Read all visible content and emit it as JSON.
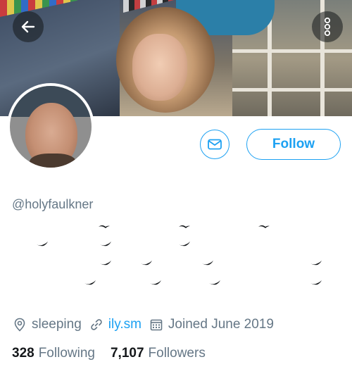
{
  "profile": {
    "handle": "@holyfaulkner",
    "location": "sleeping",
    "website": "ily.sm",
    "joined": "Joined June 2019"
  },
  "actions": {
    "follow_label": "Follow"
  },
  "stats": {
    "following_count": "328",
    "following_label": "Following",
    "followers_count": "7,107",
    "followers_label": "Followers"
  },
  "colors": {
    "accent": "#1da1f2",
    "secondary_text": "#657786",
    "primary_text": "#14171a"
  },
  "icons": {
    "back": "arrow-left-icon",
    "more": "more-vertical-icon",
    "message": "envelope-icon",
    "location": "location-pin-icon",
    "link": "link-icon",
    "calendar": "calendar-icon"
  }
}
